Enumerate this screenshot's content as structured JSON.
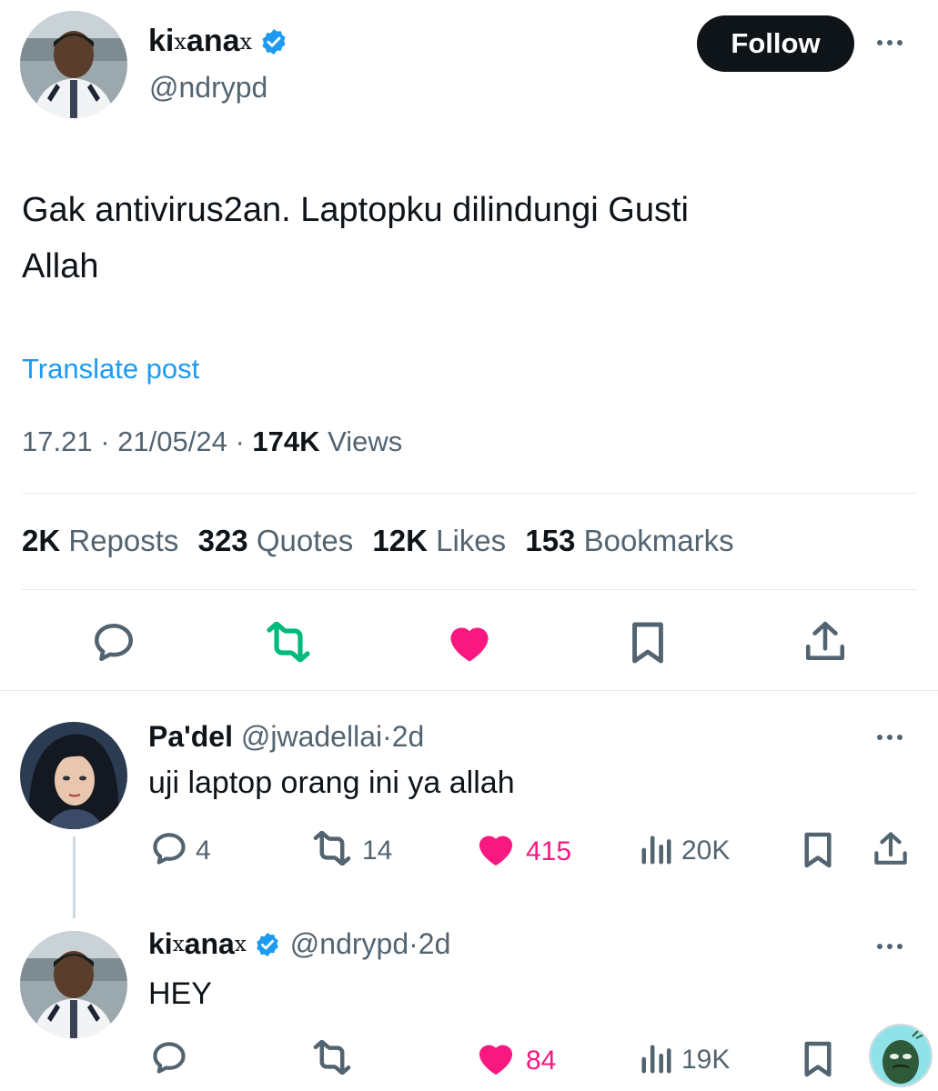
{
  "colors": {
    "text": "#0f1419",
    "secondary": "#536471",
    "accent": "#1d9bf0",
    "like": "#f91880",
    "repost": "#00ba7c",
    "follow_bg": "#0f1419"
  },
  "main_post": {
    "author": {
      "name_start": "ki",
      "name_mid_glyph": "x",
      "name_mid": "ana",
      "name_end_glyph": "x",
      "handle": "@ndrypd",
      "verified_icon": "verified-badge-icon"
    },
    "follow_label": "Follow",
    "text_line1": "Gak antivirus2an. Laptopku dilindungi Gusti",
    "text_line2": "Allah",
    "translate_label": "Translate post",
    "time": "17.21",
    "sep1": "·",
    "date": "21/05/24",
    "sep2": "·",
    "views_count": "174K",
    "views_label": "Views",
    "stats": {
      "reposts_count": "2K",
      "reposts_label": "Reposts",
      "quotes_count": "323",
      "quotes_label": "Quotes",
      "likes_count": "12K",
      "likes_label": "Likes",
      "bookmarks_count": "153",
      "bookmarks_label": "Bookmarks"
    },
    "actions": [
      "reply-icon",
      "repost-icon",
      "like-icon",
      "bookmark-icon",
      "share-icon"
    ]
  },
  "replies": [
    {
      "name": "Pa'del",
      "handle": "@jwadellai",
      "sep": "·",
      "age": "2d",
      "text": "uji laptop orang ini ya allah",
      "replies": "4",
      "reposts": "14",
      "likes": "415",
      "views": "20K"
    },
    {
      "name_start": "ki",
      "name_mid_glyph": "x",
      "name_mid": "ana",
      "name_end_glyph": "x",
      "handle": "@ndrypd",
      "sep": "·",
      "age": "2d",
      "text": "HEY",
      "replies": "",
      "reposts": "",
      "likes": "84",
      "views": "19K"
    }
  ]
}
